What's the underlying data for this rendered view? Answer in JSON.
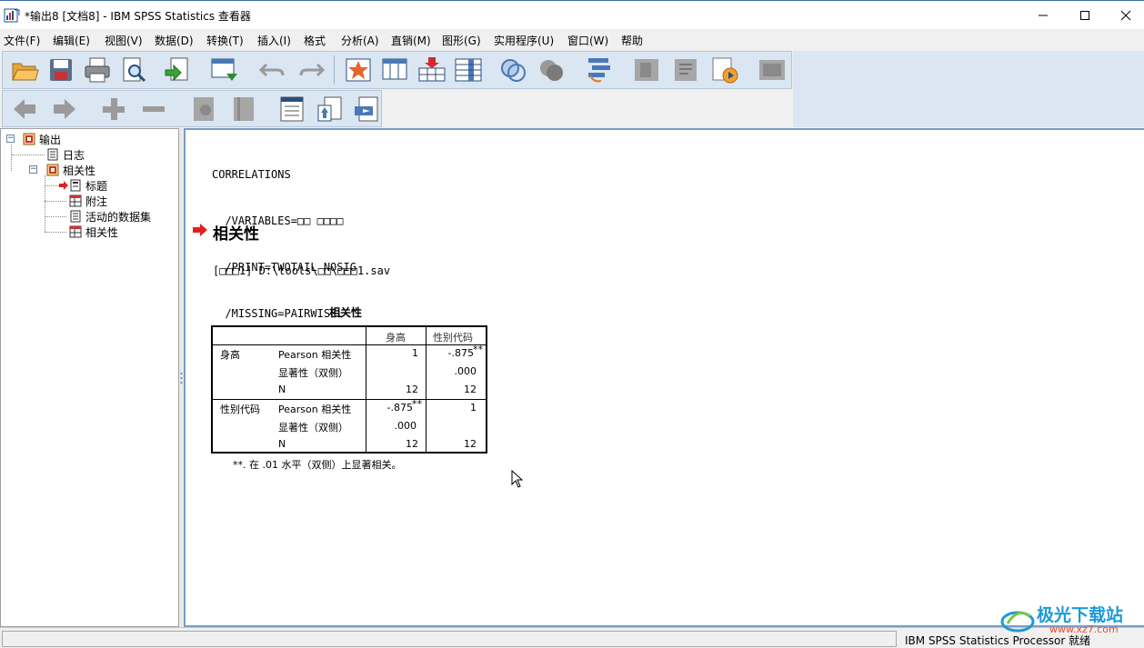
{
  "window": {
    "title": "*输出8 [文档8] - IBM SPSS Statistics 查看器",
    "controls": {
      "minimize": "minimize-icon",
      "maximize": "maximize-icon",
      "close": "close-icon"
    }
  },
  "menu": [
    "文件(F)",
    "编辑(E)",
    "视图(V)",
    "数据(D)",
    "转换(T)",
    "插入(I)",
    "格式",
    "分析(A)",
    "直销(M)",
    "图形(G)",
    "实用程序(U)",
    "窗口(W)",
    "帮助"
  ],
  "tree": {
    "root": "输出",
    "log": "日志",
    "correlations": "相关性",
    "children": [
      "标题",
      "附注",
      "活动的数据集",
      "相关性"
    ]
  },
  "output": {
    "syntax": [
      "CORRELATIONS",
      "  /VARIABLES=□□ □□□□",
      "  /PRINT=TWOTAIL NOSIG",
      "  /MISSING=PAIRWISE."
    ],
    "section_title": "相关性",
    "dataset": "[□□□1] D:\\tools\\□□\\□□□1.sav",
    "table": {
      "caption": "相关性",
      "col_headers": [
        "身高",
        "性别代码"
      ],
      "rows": [
        {
          "var": "身高",
          "stat": "Pearson 相关性",
          "c1": "1",
          "c2": "-.875",
          "c2_sup": "**"
        },
        {
          "var": "",
          "stat": "显著性（双侧）",
          "c1": "",
          "c2": ".000"
        },
        {
          "var": "",
          "stat": "N",
          "c1": "12",
          "c2": "12"
        },
        {
          "var": "性别代码",
          "stat": "Pearson 相关性",
          "c1": "-.875",
          "c1_sup": "**",
          "c2": "1"
        },
        {
          "var": "",
          "stat": "显著性（双侧）",
          "c1": ".000",
          "c2": ""
        },
        {
          "var": "",
          "stat": "N",
          "c1": "12",
          "c2": "12"
        }
      ],
      "footnote_mark": "**",
      "footnote": ". 在 .01 水平（双侧）上显著相关。"
    }
  },
  "status": "IBM SPSS Statistics Processor 就绪",
  "watermark": {
    "title": "极光下载站",
    "url": "www.xz7.com"
  },
  "colors": {
    "toolbar_bg": "#dbe6f3",
    "pane_border": "#7a9cc4",
    "arrow_red": "#e02020"
  }
}
